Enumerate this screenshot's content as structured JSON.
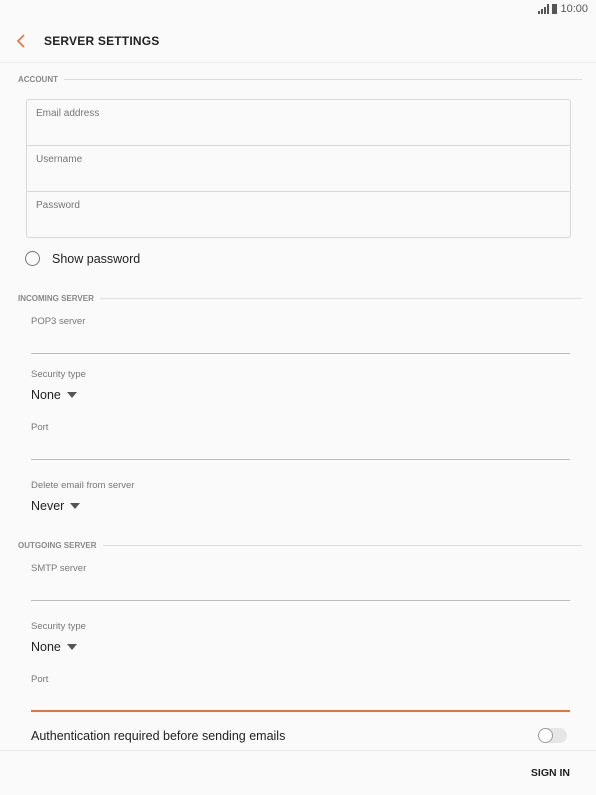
{
  "status_bar": {
    "time": "10:00"
  },
  "header": {
    "title": "SERVER SETTINGS",
    "back_icon": "chevron-left-icon",
    "accent_color": "#e8733c"
  },
  "account": {
    "section_label": "ACCOUNT",
    "fields": [
      {
        "label": "Email address",
        "value": ""
      },
      {
        "label": "Username",
        "value": ""
      },
      {
        "label": "Password",
        "value": ""
      }
    ],
    "show_password_label": "Show password",
    "show_password_checked": false
  },
  "incoming": {
    "section_label": "INCOMING SERVER",
    "server_label": "POP3 server",
    "server_value": "",
    "security_label": "Security type",
    "security_value": "None",
    "port_label": "Port",
    "port_value": "",
    "delete_label": "Delete email from server",
    "delete_value": "Never"
  },
  "outgoing": {
    "section_label": "OUTGOING SERVER",
    "server_label": "SMTP server",
    "server_value": "",
    "security_label": "Security type",
    "security_value": "None",
    "port_label": "Port",
    "port_value": "",
    "auth_label": "Authentication required before sending emails",
    "auth_enabled": false
  },
  "footer": {
    "sign_in_label": "SIGN IN"
  }
}
